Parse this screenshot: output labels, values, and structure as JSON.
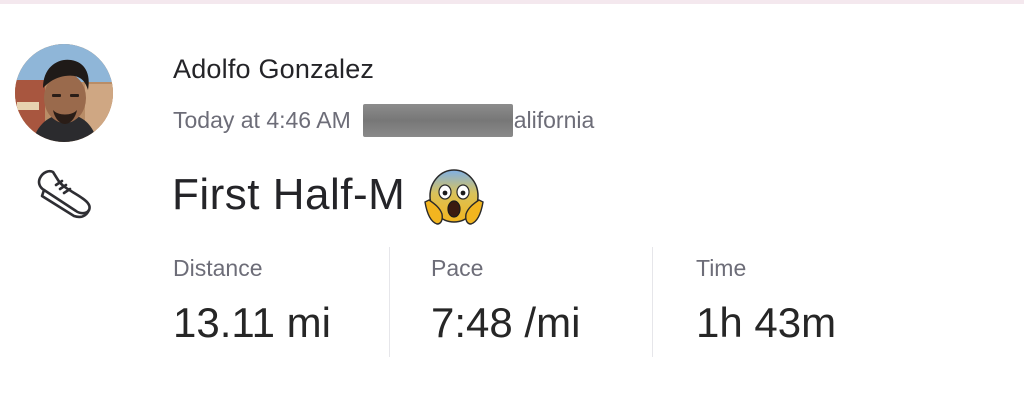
{
  "athlete": {
    "name": "Adolfo Gonzalez",
    "avatar": "profile-photo"
  },
  "activity": {
    "timestamp": "Today at 4:46 AM",
    "location_partial": "alifornia",
    "type_icon": "running-shoe-icon",
    "title": "First Half-M",
    "title_emoji": "face-screaming-in-fear",
    "stats": {
      "distance": {
        "label": "Distance",
        "value": "13.11 mi"
      },
      "pace": {
        "label": "Pace",
        "value": "7:48 /mi"
      },
      "time": {
        "label": "Time",
        "value": "1h 43m"
      }
    }
  },
  "colors": {
    "primary_text": "#242428",
    "secondary_text": "#6d6d78",
    "redaction": "#808080",
    "divider": "#e6e6ea",
    "header_strip": "#f4e8ee"
  }
}
